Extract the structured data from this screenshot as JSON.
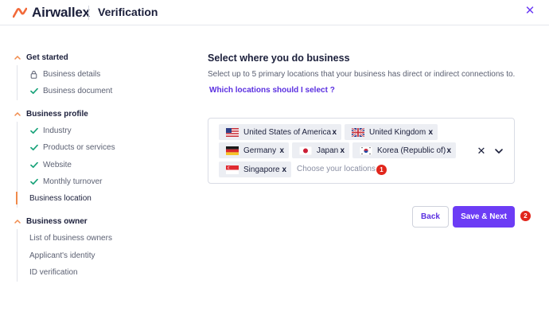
{
  "header": {
    "brand": "Airwallex",
    "title": "Verification",
    "close_glyph": "✕",
    "brand_color": "#f26a3a"
  },
  "sidebar": {
    "sections": [
      {
        "title": "Get started",
        "steps": [
          {
            "label": "Business details",
            "icon": "lock-icon"
          },
          {
            "label": "Business document",
            "icon": "check-icon"
          }
        ]
      },
      {
        "title": "Business profile",
        "steps": [
          {
            "label": "Industry",
            "icon": "check-icon"
          },
          {
            "label": "Products or services",
            "icon": "check-icon"
          },
          {
            "label": "Website",
            "icon": "check-icon"
          },
          {
            "label": "Monthly turnover",
            "icon": "check-icon"
          },
          {
            "label": "Business location",
            "icon": "none"
          }
        ]
      },
      {
        "title": "Business owner",
        "steps": [
          {
            "label": "List of business owners",
            "icon": "none"
          },
          {
            "label": "Applicant's identity",
            "icon": "none"
          },
          {
            "label": "ID verification",
            "icon": "none"
          }
        ]
      }
    ]
  },
  "main": {
    "title": "Select where you do business",
    "subtitle": "Select up to 5 primary locations that your business has direct or indirect connections to.",
    "help_link": "Which locations should I select ?",
    "locations": [
      {
        "label": "United States of America",
        "flag": "us-flag-icon"
      },
      {
        "label": "United Kingdom",
        "flag": "uk-flag-icon"
      },
      {
        "label": "Germany",
        "flag": "germany-flag-icon"
      },
      {
        "label": "Japan",
        "flag": "japan-flag-icon"
      },
      {
        "label": "Korea (Republic of)",
        "flag": "korea-flag-icon"
      },
      {
        "label": "Singapore",
        "flag": "singapore-flag-icon"
      }
    ],
    "remove_glyph": "x",
    "placeholder": "Choose your locations",
    "clear_glyph": "✕",
    "badge_1": "1",
    "badge_2": "2",
    "back_label": "Back",
    "next_label": "Save & Next",
    "accent_color": "#6c3cf5"
  }
}
